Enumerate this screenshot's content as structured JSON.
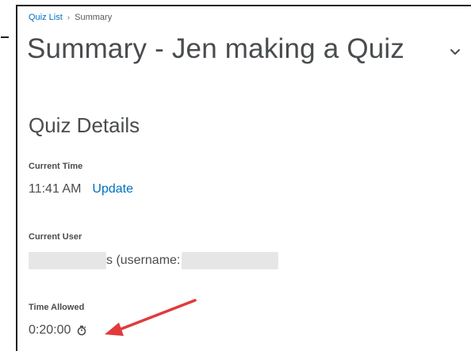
{
  "breadcrumb": {
    "link": "Quiz List",
    "separator": "›",
    "current": "Summary"
  },
  "page": {
    "title": "Summary - Jen making a Quiz"
  },
  "quiz_details": {
    "heading": "Quiz Details",
    "current_time": {
      "label": "Current Time",
      "value": "11:41 AM",
      "update_label": "Update"
    },
    "current_user": {
      "label": "Current User",
      "visible_suffix": "s (username:"
    },
    "time_allowed": {
      "label": "Time Allowed",
      "value": "0:20:00",
      "icon": "stopwatch-icon"
    }
  },
  "annotation": {
    "arrow_color": "#e23a3a",
    "icon": "red-arrow-icon"
  },
  "colors": {
    "link": "#006fbf",
    "text": "#494c4e"
  }
}
